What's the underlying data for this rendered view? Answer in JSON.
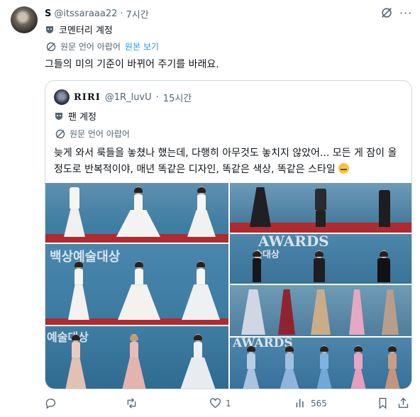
{
  "post": {
    "display_name": "S",
    "handle": "@itssaraaa22",
    "separator": "·",
    "time": "7시간",
    "label": "코멘터리 계정",
    "translate": {
      "text": "원문 언어 아랍어",
      "link": "원본 보기"
    },
    "text": "그들의 미의 기준이 바뀌어 주기를 바래요."
  },
  "quote": {
    "display_name": "RIRI",
    "handle": "@1R_luvU",
    "separator": "·",
    "time": "15시간",
    "label": "팬 계정",
    "translate": {
      "text": "원문 언어 아랍어"
    },
    "text": "늦게 와서 룩들을 놓쳤나 했는데, 다행히 아무것도 놓치지 않았어... 모든 게 잠이 올 정도로 반복적이야, 매년 똑같은 디자인, 똑같은 색상, 똑같은 스타일",
    "emoji": "expressionless-face"
  },
  "media": {
    "backdrop_text": [
      "AWARDS",
      "백상예술대상",
      "AWARDS",
      "술대상",
      "예술대상"
    ]
  },
  "actions": {
    "reply_count": "",
    "retweet_count": "",
    "like_count": "1",
    "views_count": "565"
  },
  "colors": {
    "accent": "#1d9bf0",
    "secondary_text": "#536471",
    "border": "#cfd9de",
    "backdrop_blue": "#3f7ea3",
    "carpet_red": "#b02a2f"
  }
}
